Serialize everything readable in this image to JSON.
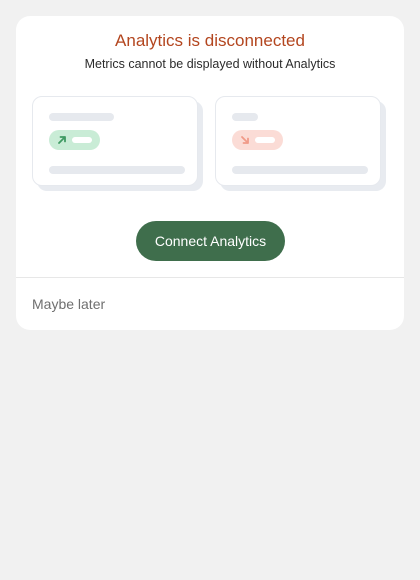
{
  "card": {
    "title": "Analytics is disconnected",
    "subtitle": "Metrics cannot be displayed without Analytics",
    "connect_label": "Connect Analytics",
    "later_label": "Maybe later"
  },
  "colors": {
    "title": "#b3461f",
    "button": "#3f6e4c",
    "positive_pill": "#c9ecd6",
    "positive_arrow": "#3f9a62",
    "negative_pill": "#fbdcd6",
    "negative_arrow": "#f09a88"
  },
  "icons": {
    "trend_up": "arrow-up-right-icon",
    "trend_down": "arrow-down-right-icon"
  }
}
